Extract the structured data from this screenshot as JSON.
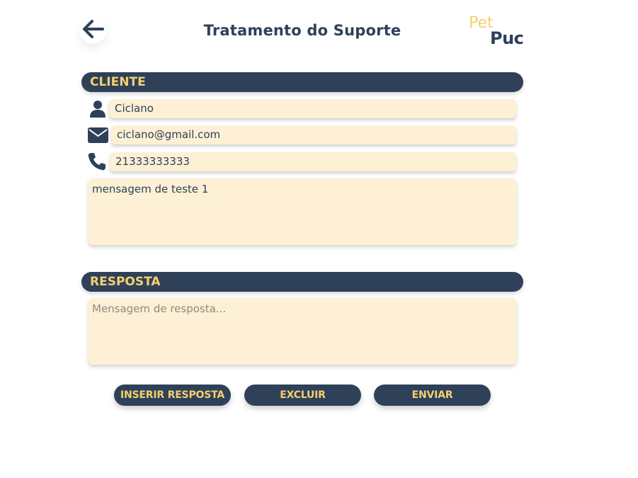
{
  "header": {
    "title": "Tratamento do Suporte",
    "back_icon": "arrow-left-icon",
    "logo": {
      "pet": "Pet",
      "puc": "Puc"
    }
  },
  "cliente": {
    "section_label": "CLIENTE",
    "name": "Ciclano",
    "email": "ciclano@gmail.com",
    "phone": "21333333333",
    "message": "mensagem de teste 1",
    "icons": {
      "name": "user-icon",
      "email": "envelope-icon",
      "phone": "phone-icon"
    }
  },
  "resposta": {
    "section_label": "RESPOSTA",
    "placeholder": "Mensagem de resposta..."
  },
  "actions": {
    "insert_label": "INSERIR RESPOSTA",
    "delete_label": "EXCLUIR",
    "send_label": "ENVIAR"
  },
  "colors": {
    "navy": "#2e4159",
    "gold": "#f6cf6e",
    "cream": "#fdf0d4"
  }
}
